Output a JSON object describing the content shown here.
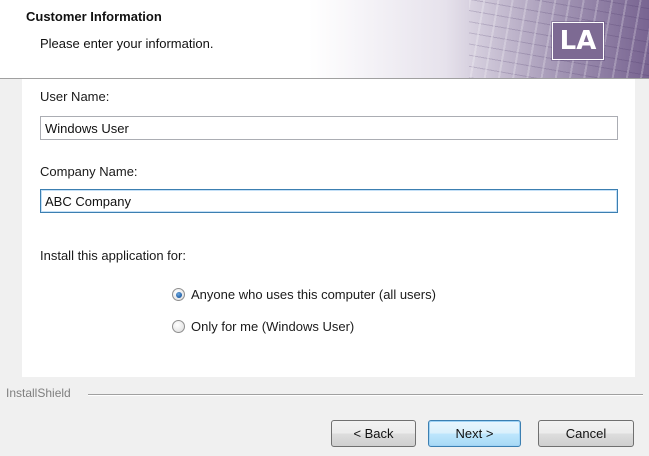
{
  "header": {
    "title": "Customer Information",
    "subtitle": "Please enter your information.",
    "logo_text": "LA"
  },
  "form": {
    "user_name_label": "User Name:",
    "user_name_value": "Windows User",
    "company_name_label": "Company Name:",
    "company_name_value": "ABC Company",
    "install_for_label": "Install this application for:",
    "options": [
      {
        "label": "Anyone who uses this computer (all users)",
        "checked": true
      },
      {
        "label": "Only for me (Windows User)",
        "checked": false
      }
    ]
  },
  "footer": {
    "brand": "InstallShield",
    "back_label": "< Back",
    "next_label": "Next >",
    "cancel_label": "Cancel"
  },
  "colors": {
    "accent": "#7d6a93",
    "focus_border": "#3c7fb1"
  }
}
